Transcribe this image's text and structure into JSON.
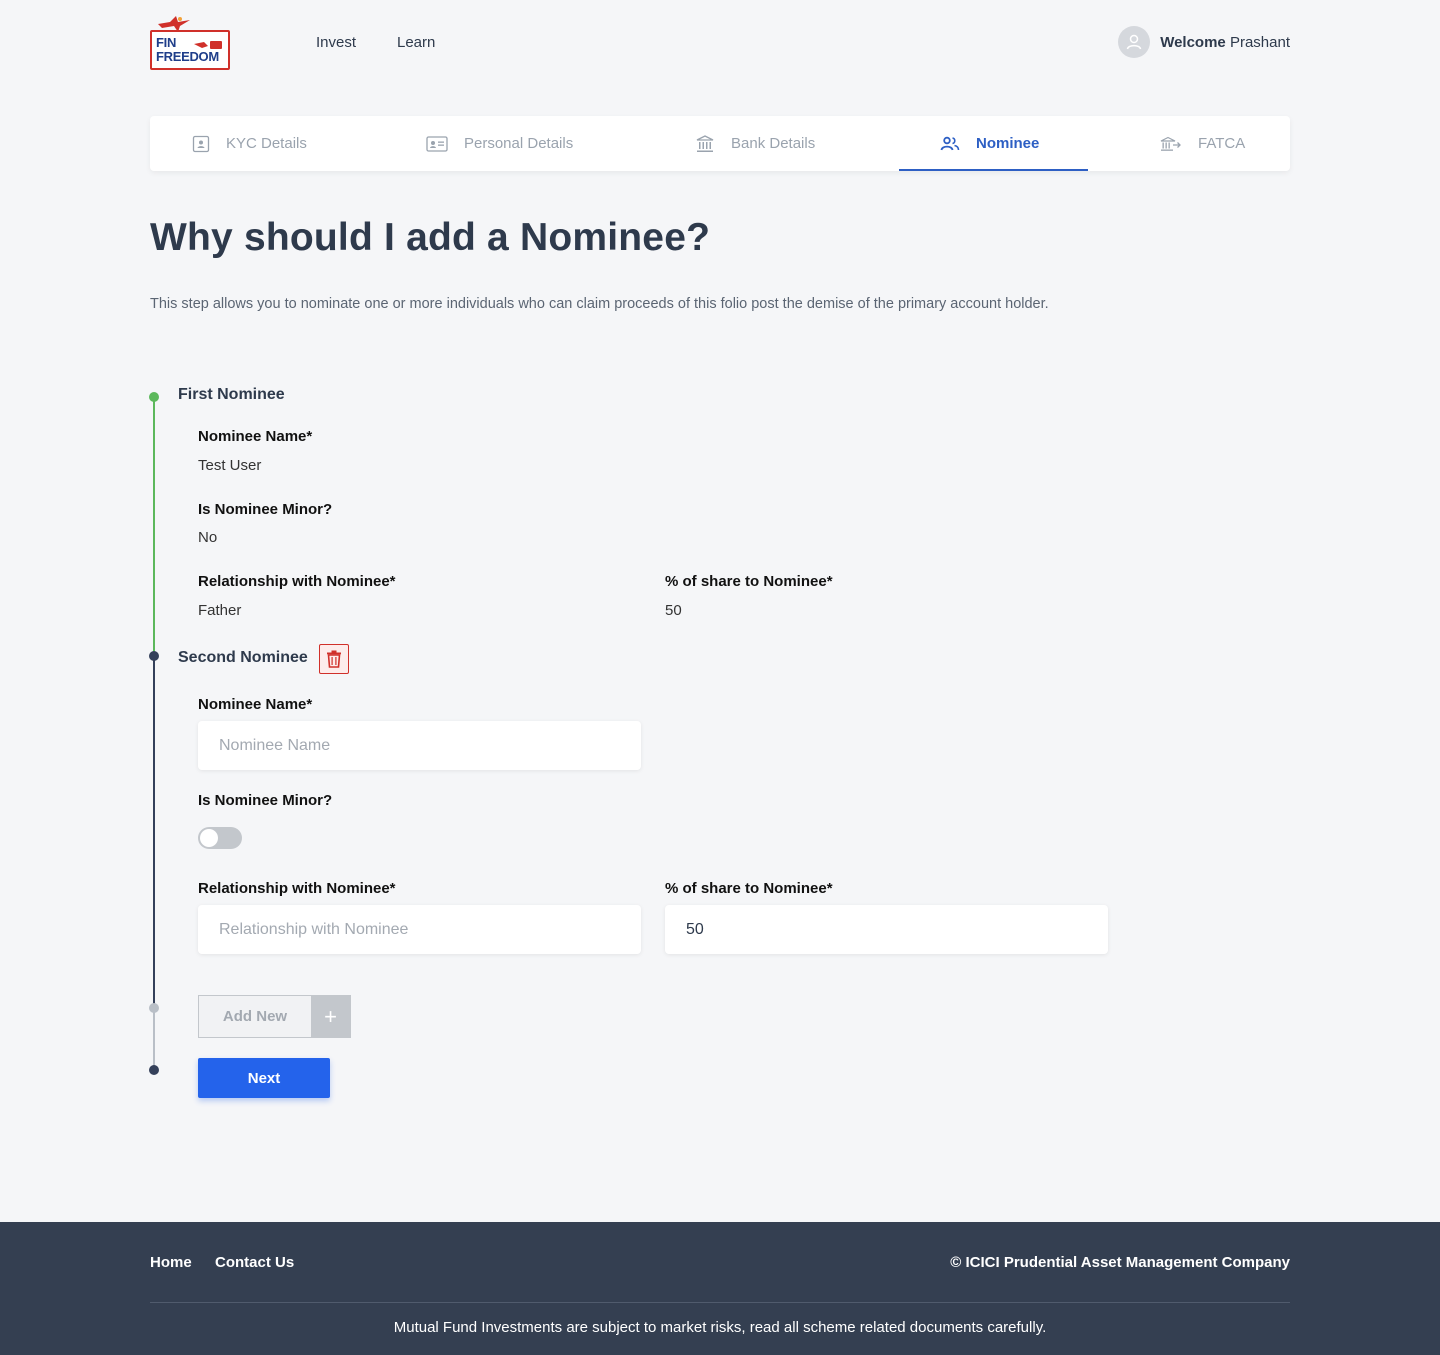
{
  "brand": {
    "logo_line1": "FIN",
    "logo_line2": "FREEDOM",
    "accent": "#2463eb",
    "logo_red": "#d0302a",
    "logo_blue": "#1f3e8a"
  },
  "nav": {
    "items": [
      "Invest",
      "Learn"
    ]
  },
  "user": {
    "welcome_label": "Welcome",
    "name": "Prashant"
  },
  "stepper": {
    "steps": [
      {
        "label": "KYC Details",
        "icon": "id-card-icon"
      },
      {
        "label": "Personal Details",
        "icon": "profile-card-icon"
      },
      {
        "label": "Bank Details",
        "icon": "bank-icon"
      },
      {
        "label": "Nominee",
        "icon": "users-icon"
      },
      {
        "label": "FATCA",
        "icon": "bank-transfer-icon"
      }
    ],
    "active": "Nominee"
  },
  "main": {
    "title": "Why should I add a Nominee?",
    "description": "This step allows you to nominate one or more individuals who can claim proceeds of this folio post the demise of the primary account holder."
  },
  "first_nominee": {
    "title": "First Nominee",
    "name_label": "Nominee Name*",
    "name_value": "Test User",
    "minor_label": "Is Nominee Minor?",
    "minor_value": "No",
    "relationship_label": "Relationship with Nominee*",
    "relationship_value": "Father",
    "share_label": "% of share to Nominee*",
    "share_value": "50"
  },
  "second_nominee": {
    "title": "Second Nominee",
    "name_label": "Nominee Name*",
    "name_placeholder": "Nominee Name",
    "minor_label": "Is Nominee Minor?",
    "minor_on": false,
    "relationship_label": "Relationship with Nominee*",
    "relationship_placeholder": "Relationship with Nominee",
    "share_label": "% of share to Nominee*",
    "share_value": "50"
  },
  "actions": {
    "add_new_label": "Add New",
    "add_new_icon": "+",
    "next_label": "Next"
  },
  "footer": {
    "links": [
      "Home",
      "Contact Us"
    ],
    "copyright": "© ICICI Prudential Asset Management Company",
    "disclaimer": "Mutual Fund Investments are subject to market risks, read all scheme related documents carefully."
  }
}
